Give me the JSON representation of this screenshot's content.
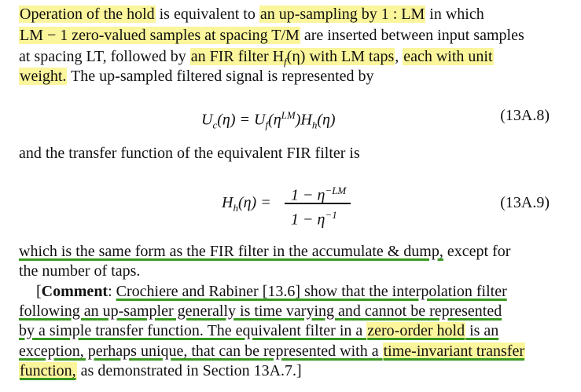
{
  "para1": {
    "l1_a": "Operation of the hold",
    "l1_b": " is equivalent to ",
    "l1_c": "an up-sampling by 1 : LM",
    "l1_d": " in which",
    "l2_a": "LM − 1 zero-valued samples at spacing T/M",
    "l2_b": " are inserted between input samples",
    "l3_a": "at spacing LT, followed by ",
    "l3_b": "an FIR filter H",
    "l3_b_sub": "f",
    "l3_c": "(η) with LM taps",
    "l3_d": ", ",
    "l3_e": "each with unit",
    "l4_a": "weight.",
    "l4_b": " The up-sampled filtered signal is represented by"
  },
  "eq8": {
    "lhs": "U",
    "lhs_sub": "c",
    "lhs_arg": "(η) = U",
    "rhs_sub": "f",
    "rhs_arg": "(η",
    "rhs_sup": "LM",
    "rhs_tail": ")H",
    "h_sub": "h",
    "h_arg": "(η)",
    "number": "(13A.8)"
  },
  "para2": {
    "text": "and the transfer function of the equivalent FIR filter is"
  },
  "eq9": {
    "lhs": "H",
    "lhs_sub": "h",
    "lhs_arg": "(η) =",
    "num": "1 − η",
    "num_sup": "−LM",
    "den": "1 − η",
    "den_sup": "−1",
    "number": "(13A.9)"
  },
  "para3": {
    "l1_a": "which is the same form as the FIR filter in the accumulate & dump,",
    "l1_b": " except for",
    "l2": "the number of taps."
  },
  "comment": {
    "open": "[",
    "label": "Comment",
    "l1_a": ": ",
    "l1_b": "Crochiere and Rabiner [13.6] show that the interpolation filter",
    "l2": "following an up-sampler generally is time varying and cannot be represented",
    "l3_a": "by a simple transfer function. The equivalent filter in a ",
    "l3_b": "zero-order hold",
    "l3_c": " is an",
    "l4_a": "exception, perhaps unique, that can be represented with a ",
    "l4_b": "time-invariant transfer",
    "l5_a": "function,",
    "l5_b": " as demonstrated in Section 13A.7.]"
  },
  "colors": {
    "highlight": "#fbf59b",
    "underline": "#3a9a22"
  }
}
